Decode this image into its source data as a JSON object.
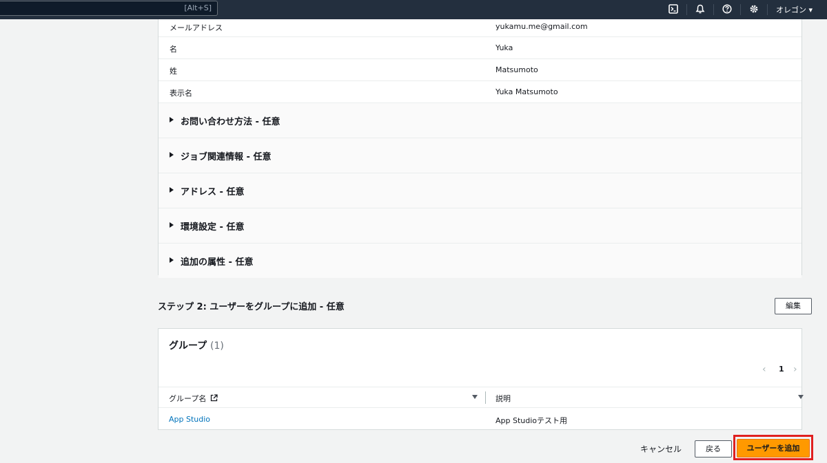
{
  "topbar": {
    "search_shortcut": "[Alt+S]",
    "icons": [
      "cloudshell-icon",
      "bell-icon",
      "help-icon",
      "gear-icon"
    ],
    "region": "オレゴン ▾"
  },
  "attributes": [
    {
      "key": "メールアドレス",
      "value": "yukamu.me@gmail.com"
    },
    {
      "key": "名",
      "value": "Yuka"
    },
    {
      "key": "姓",
      "value": "Matsumoto"
    },
    {
      "key": "表示名",
      "value": "Yuka Matsumoto"
    }
  ],
  "sections": [
    "お問い合わせ方法 - 任意",
    "ジョブ関連情報 - 任意",
    "アドレス - 任意",
    "環境設定 - 任意",
    "追加の属性 - 任意"
  ],
  "step2": {
    "title": "ステップ 2: ユーザーをグループに追加 - 任意",
    "edit_label": "編集"
  },
  "groups": {
    "title": "グループ",
    "count": "(1)",
    "pager": {
      "prev": "‹",
      "page": "1",
      "next": "›"
    },
    "columns": [
      "グループ名",
      "説明"
    ],
    "rows": [
      {
        "name": "App Studio",
        "description": "App Studioテスト用"
      }
    ]
  },
  "footer": {
    "cancel_label": "キャンセル",
    "back_label": "戻る",
    "submit_label": "ユーザーを追加"
  },
  "colors": {
    "topbar": "#232f3e",
    "primary": "#ff9900",
    "link": "#0073bb",
    "highlight": "#e02020"
  }
}
